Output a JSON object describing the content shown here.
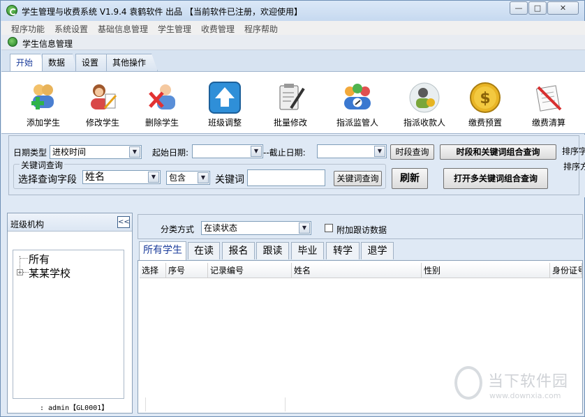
{
  "window": {
    "title": "学生管理与收费系统 V1.9.4 袁鹤软件 出品 【当前软件已注册，欢迎使用】",
    "controls": {
      "minimize": "—",
      "maximize": "□",
      "close": "✕"
    }
  },
  "menu": [
    "程序功能",
    "系统设置",
    "基础信息管理",
    "学生管理",
    "收费管理",
    "程序帮助"
  ],
  "document": {
    "title": "学生信息管理"
  },
  "ribbon": {
    "tabs": [
      "开始",
      "数据",
      "设置",
      "其他操作"
    ],
    "active_tab": "开始",
    "buttons": [
      {
        "label": "添加学生",
        "icon": "add-student-icon"
      },
      {
        "label": "修改学生",
        "icon": "edit-student-icon"
      },
      {
        "label": "删除学生",
        "icon": "delete-student-icon"
      },
      {
        "label": "班级调整",
        "icon": "class-adjust-icon"
      },
      {
        "label": "批量修改",
        "icon": "batch-edit-icon"
      },
      {
        "label": "指派监管人",
        "icon": "assign-supervisor-icon"
      },
      {
        "label": "指派收款人",
        "icon": "assign-payee-icon"
      },
      {
        "label": "缴费预置",
        "icon": "payment-preset-icon"
      },
      {
        "label": "缴费清算",
        "icon": "payment-settle-icon"
      }
    ]
  },
  "filter": {
    "date_type_label": "日期类型",
    "date_type_value": "进校时间",
    "start_date_label": "起始日期:",
    "start_date_value": "",
    "end_date_label": "--截止日期:",
    "end_date_value": "",
    "date_query_button": "时段查询",
    "combined_query_button": "时段和关键词组合查询",
    "sort_label_1": "排序字",
    "sort_label_2": "排序方",
    "keyword_group_title": "关键词查询",
    "field_label": "选择查询字段",
    "field_value": "姓名",
    "match_value": "包含",
    "keyword_label": "关键词",
    "keyword_value": "",
    "keyword_query_button": "关键词查询",
    "refresh_button": "刷新",
    "multi_keyword_button": "打开多关键词组合查询"
  },
  "left_panel": {
    "title": "班级机构",
    "collapse": "<<",
    "tree": [
      "所有",
      "某某学校"
    ],
    "user_info": ": admin【GL0001】"
  },
  "right_panel": {
    "category_label": "分类方式",
    "category_value": "在读状态",
    "followup_checkbox_label": "附加跟访数据",
    "followup_checked": false,
    "tabs": [
      "所有学生",
      "在读",
      "报名",
      "跟读",
      "毕业",
      "转学",
      "退学"
    ],
    "active_tab": "所有学生",
    "columns": [
      "选择",
      "序号",
      "记录编号",
      "姓名",
      "性别",
      "身份证号"
    ]
  },
  "watermark": {
    "text": "当下软件园",
    "url": "www.downxia.com"
  },
  "colors": {
    "accent": "#1a3b9a",
    "window_bg": "#dfe9f5",
    "border": "#8aa0b8"
  }
}
